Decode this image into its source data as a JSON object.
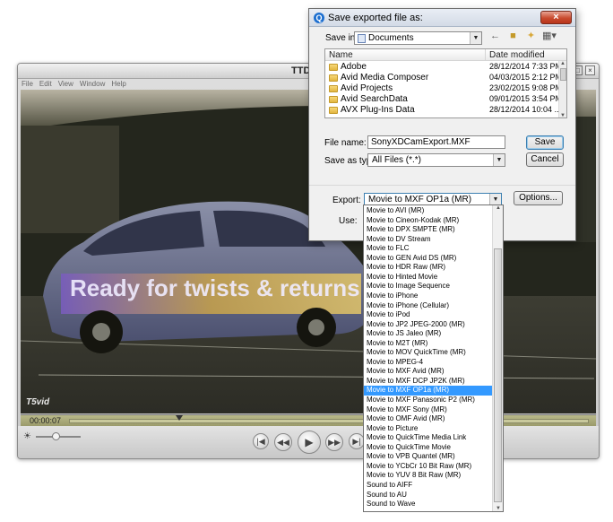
{
  "player": {
    "title": "TTDN",
    "menu": [
      "File",
      "Edit",
      "View",
      "Window",
      "Help"
    ],
    "video_text": "Ready for twists & returns",
    "logo": "T5vid",
    "timecode": "00:00:07"
  },
  "dialog": {
    "title": "Save exported file as:",
    "save_in_label": "Save in:",
    "save_in_value": "Documents",
    "columns": {
      "name": "Name",
      "date": "Date modified"
    },
    "files": [
      {
        "name": "Adobe",
        "date": "28/12/2014 7:33 PM"
      },
      {
        "name": "Avid Media Composer",
        "date": "04/03/2015 2:12 PM"
      },
      {
        "name": "Avid Projects",
        "date": "23/02/2015 9:08 PM"
      },
      {
        "name": "Avid SearchData",
        "date": "09/01/2015 3:54 PM"
      },
      {
        "name": "AVX Plug-Ins Data",
        "date": "28/12/2014 10:04 ..."
      }
    ],
    "file_name_label": "File name:",
    "file_name_value": "SonyXDCamExport.MXF",
    "save_type_label": "Save as type:",
    "save_type_value": "All Files (*.*)",
    "save_button": "Save",
    "cancel_button": "Cancel",
    "export_label": "Export:",
    "export_value": "Movie to MXF OP1a (MR)",
    "options_button": "Options...",
    "use_label": "Use:"
  },
  "export_options": [
    "Movie to AVI (MR)",
    "Movie to Cineon-Kodak (MR)",
    "Movie to DPX SMPTE (MR)",
    "Movie to DV Stream",
    "Movie to FLC",
    "Movie to GEN Avid DS (MR)",
    "Movie to HDR Raw (MR)",
    "Movie to Hinted Movie",
    "Movie to Image Sequence",
    "Movie to iPhone",
    "Movie to iPhone (Cellular)",
    "Movie to iPod",
    "Movie to JP2 JPEG-2000 (MR)",
    "Movie to JS Jaleo (MR)",
    "Movie to M2T (MR)",
    "Movie to MOV QuickTime (MR)",
    "Movie to MPEG-4",
    "Movie to MXF Avid (MR)",
    "Movie to MXF DCP JP2K (MR)",
    "Movie to MXF OP1a (MR)",
    "Movie to MXF Panasonic P2 (MR)",
    "Movie to MXF Sony (MR)",
    "Movie to OMF Avid (MR)",
    "Movie to Picture",
    "Movie to QuickTime Media Link",
    "Movie to QuickTime Movie",
    "Movie to VPB Quantel (MR)",
    "Movie to YCbCr 10 Bit Raw (MR)",
    "Movie to YUV 8 Bit Raw (MR)",
    "Sound to AIFF",
    "Sound to AU",
    "Sound to Wave"
  ],
  "selected_export_index": 19,
  "colors": {
    "selection": "#3399ff",
    "close_button": "#c94b2f",
    "timebar": "#b9b989"
  }
}
